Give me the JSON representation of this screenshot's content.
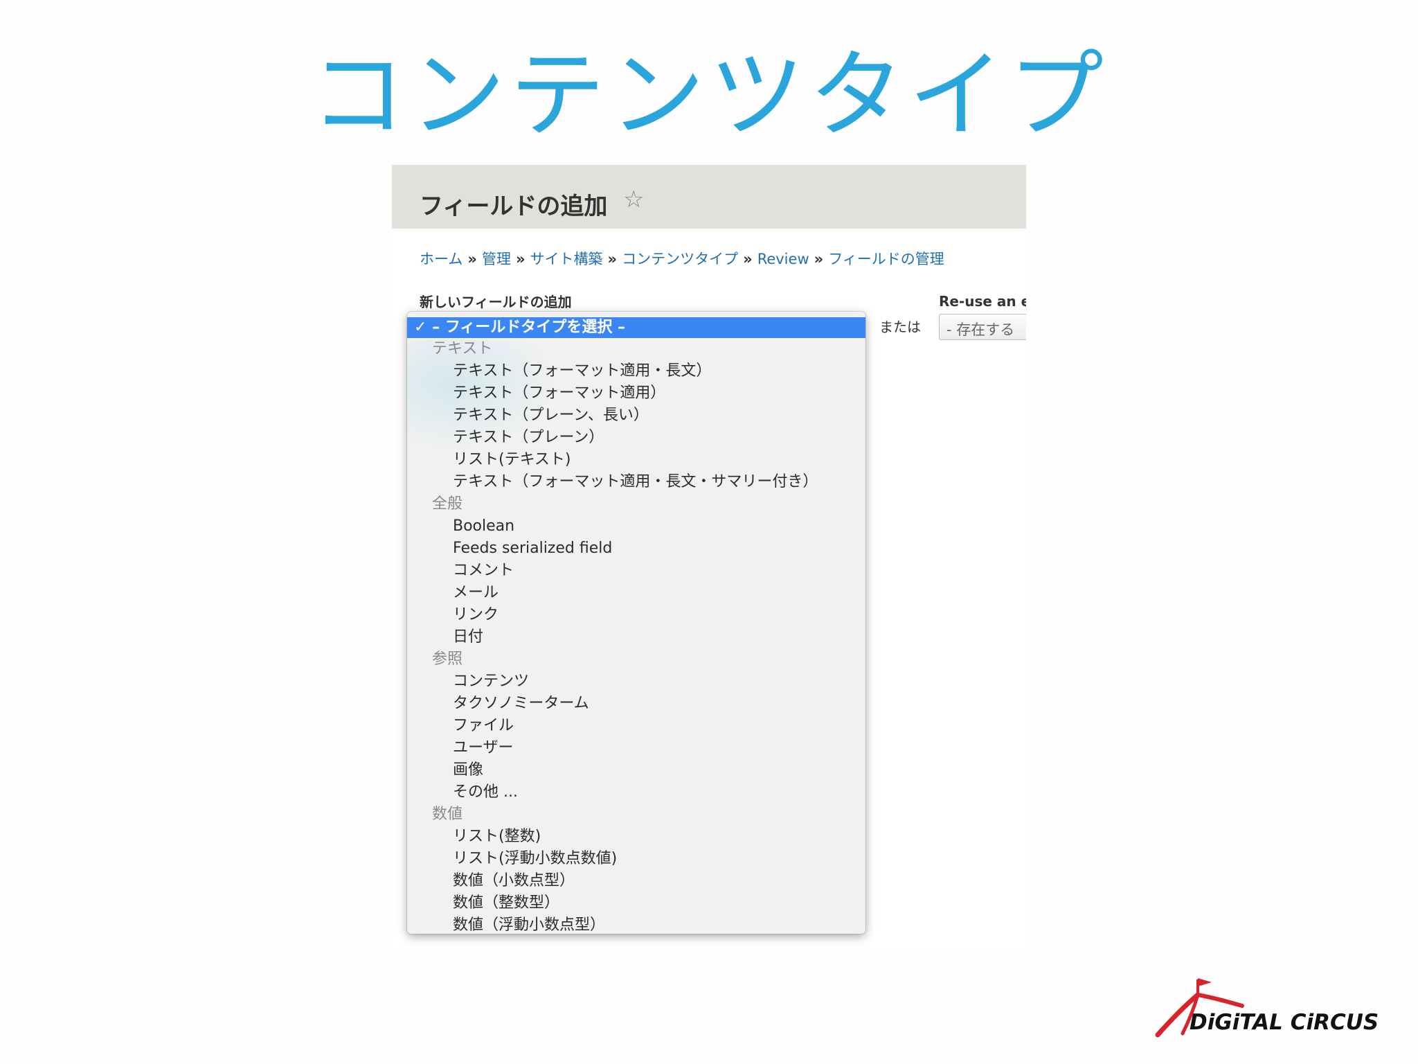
{
  "slide": {
    "title": "コンテンツタイプ"
  },
  "screen": {
    "page_title": "フィールドの追加",
    "star_icon": "☆",
    "breadcrumb": [
      "ホーム",
      "管理",
      "サイト構築",
      "コンテンツタイプ",
      "Review",
      "フィールドの管理"
    ],
    "breadcrumb_separator": "»",
    "new_field_label": "新しいフィールドの追加",
    "or_label": "または",
    "reuse_label": "Re-use an e",
    "existing_select_value": "- 存在する",
    "dropdown": {
      "selected": "✓ – フィールドタイプを選択 –",
      "groups": [
        {
          "label": "テキスト",
          "items": [
            "テキスト（フォーマット適用・長文）",
            "テキスト（フォーマット適用）",
            "テキスト（プレーン、長い）",
            "テキスト（プレーン）",
            "リスト(テキスト)",
            "テキスト（フォーマット適用・長文・サマリー付き）"
          ]
        },
        {
          "label": "全般",
          "items": [
            "Boolean",
            "Feeds serialized field",
            "コメント",
            "メール",
            "リンク",
            "日付"
          ]
        },
        {
          "label": "参照",
          "items": [
            "コンテンツ",
            "タクソノミーターム",
            "ファイル",
            "ユーザー",
            "画像",
            "その他 ..."
          ]
        },
        {
          "label": "数値",
          "items": [
            "リスト(整数)",
            "リスト(浮動小数点数値)",
            "数値（小数点型）",
            "数値（整数型）",
            "数値（浮動小数点型）"
          ]
        }
      ]
    }
  },
  "logo": {
    "text": "DiGiTAL CiRCUS",
    "colors": {
      "red": "#d8232a",
      "black": "#111111"
    }
  },
  "colors": {
    "title": "#2aa6dc",
    "header_bg": "#e1e1dc",
    "link": "#1f6fb5",
    "selected_bg": "#3a86f5"
  }
}
